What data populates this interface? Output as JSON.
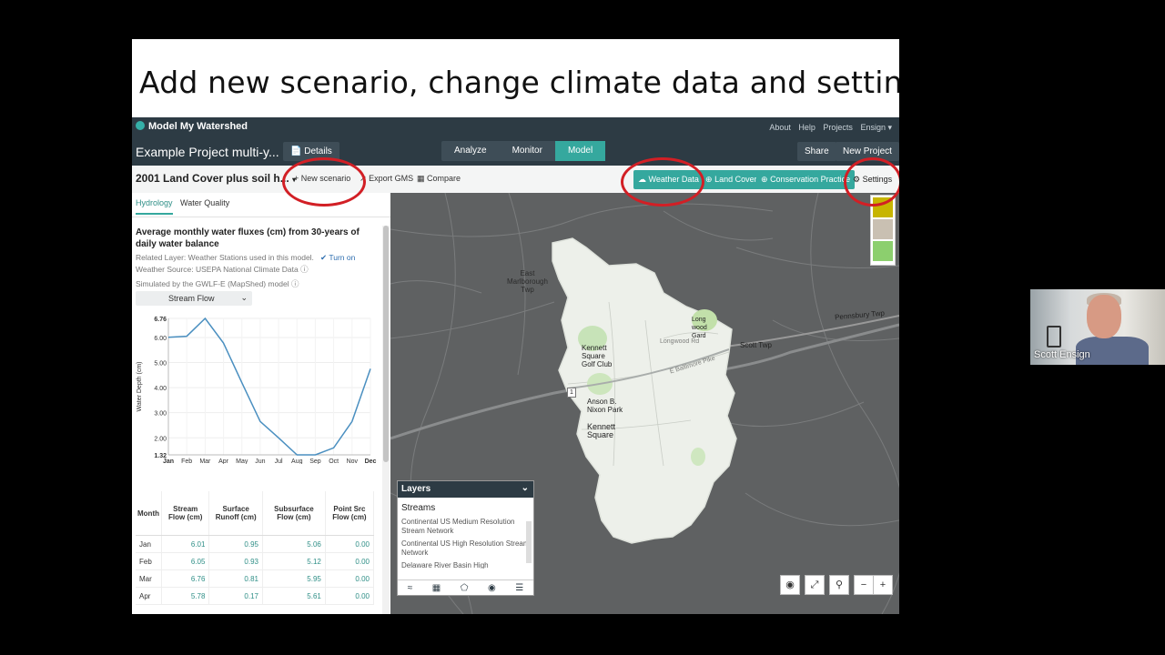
{
  "slide": {
    "title": "Add new scenario, change climate data and settings"
  },
  "app": {
    "brand": "Model My Watershed",
    "top_links": [
      "About",
      "Help",
      "Projects",
      "Ensign ▾"
    ],
    "project_title": "Example Project multi-y...",
    "details_label": "Details",
    "tabs": [
      "Analyze",
      "Monitor",
      "Model"
    ],
    "active_tab": "Model",
    "share_label": "Share",
    "new_project_label": "New Project",
    "scenario_title": "2001 Land Cover plus soil h...",
    "new_scenario_label": "+ New scenario",
    "export_label": "Export GMS",
    "compare_label": "Compare",
    "weather_label": "Weather Data",
    "land_cover_label": "Land Cover",
    "conservation_label": "Conservation Practice",
    "settings_label": "Settings",
    "accent_color": "#35a89e",
    "highlight_color": "#d21f25"
  },
  "panel": {
    "tabs": [
      "Hydrology",
      "Water Quality"
    ],
    "active_tab": "Hydrology",
    "heading": "Average monthly water fluxes (cm) from 30-years of daily water balance",
    "related_layer": "Related Layer: Weather Stations used in this model.",
    "turn_on": "✔ Turn on",
    "weather_source": "Weather Source: USEPA National Climate Data",
    "simulated_by": "Simulated by the GWLF-E (MapShed) model",
    "select_value": "Stream Flow",
    "table_headers": [
      "Month",
      "Stream Flow (cm)",
      "Surface Runoff (cm)",
      "Subsurface Flow (cm)",
      "Point Src Flow (cm)"
    ],
    "table_rows": [
      [
        "Jan",
        "6.01",
        "0.95",
        "5.06",
        "0.00"
      ],
      [
        "Feb",
        "6.05",
        "0.93",
        "5.12",
        "0.00"
      ],
      [
        "Mar",
        "6.76",
        "0.81",
        "5.95",
        "0.00"
      ],
      [
        "Apr",
        "5.78",
        "0.17",
        "5.61",
        "0.00"
      ]
    ]
  },
  "chart_data": {
    "type": "line",
    "title": "",
    "xlabel": "",
    "ylabel": "Water Depth (cm)",
    "categories": [
      "Jan",
      "Feb",
      "Mar",
      "Apr",
      "May",
      "Jun",
      "Jul",
      "Aug",
      "Sep",
      "Oct",
      "Nov",
      "Dec"
    ],
    "series": [
      {
        "values": [
          6.01,
          6.05,
          6.76,
          5.78,
          4.2,
          2.65,
          2.0,
          1.32,
          1.32,
          1.6,
          2.65,
          4.75
        ]
      }
    ],
    "yticks": [
      "1.32",
      "2.00",
      "3.00",
      "4.00",
      "5.00",
      "6.00",
      "6.76"
    ],
    "ylim": [
      1.32,
      6.76
    ],
    "grid": true,
    "line_color": "#4a8fc0"
  },
  "map": {
    "labels": {
      "east_marlborough": "East\nMarlborough\nTwp",
      "kennett_square_golf": "Kennett\nSquare\nGolf Club",
      "anson": "Anson B.\nNixon Park",
      "kennett_square": "Kennett\nSquare",
      "longwood": "Longwood Rd",
      "baltimore_pike": "E Baltimore Pike",
      "scott_twp": "Scott Twp",
      "pennsbury": "Pennsbury Twp",
      "longwood_gardens": "Long\nwood\nGard",
      "route_1": "1"
    },
    "legend_colors": [
      "#c7b500",
      "#c9c0b2",
      "#8ccf6e"
    ]
  },
  "layers": {
    "title": "Layers",
    "subtitle": "Streams",
    "items": [
      "Continental US Medium Resolution Stream Network",
      "Continental US High Resolution Stream Network",
      "Delaware River Basin High"
    ]
  },
  "video": {
    "name": "Scott Ensign"
  }
}
